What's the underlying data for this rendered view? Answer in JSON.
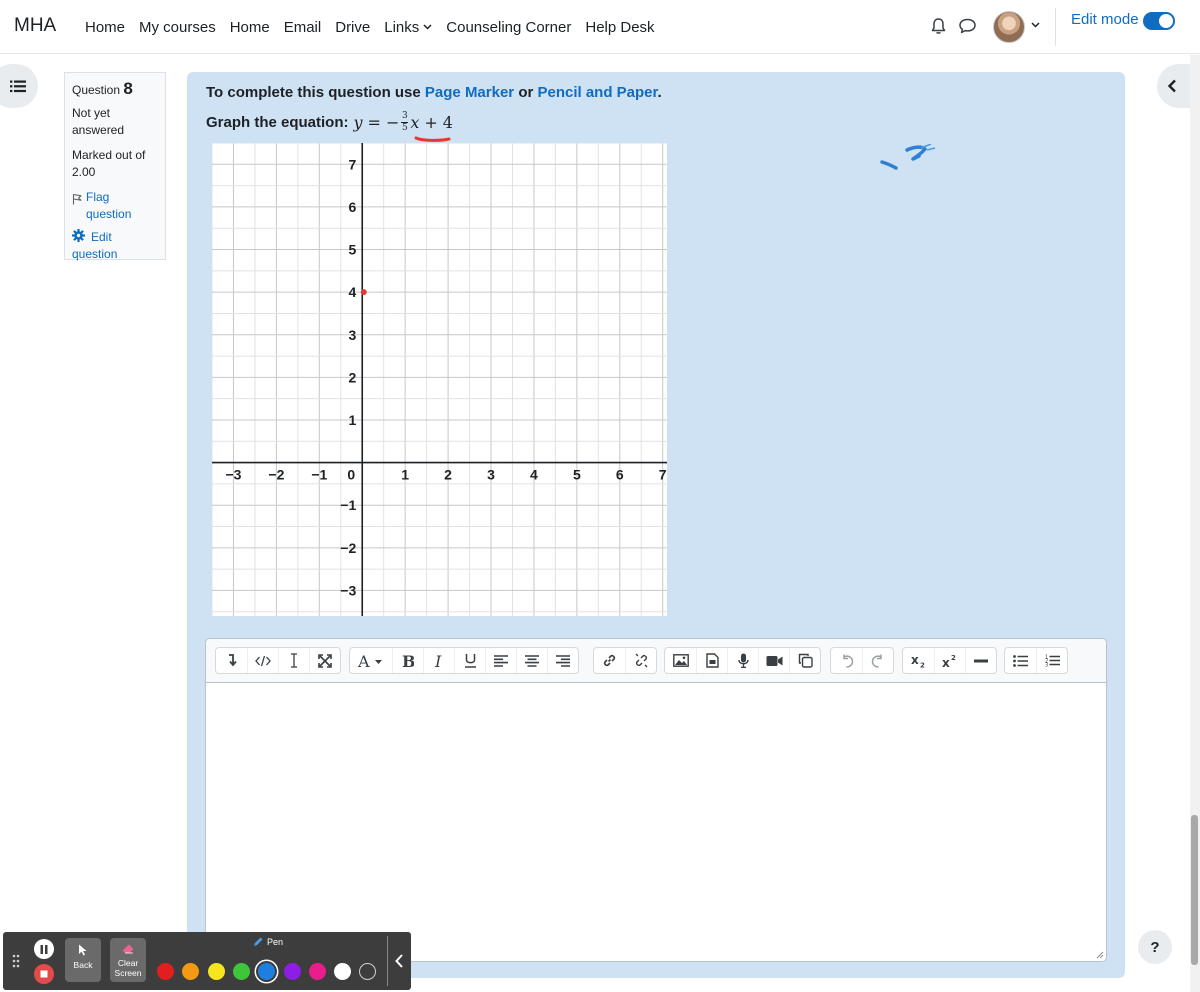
{
  "navbar": {
    "brand": "MHA",
    "links": [
      {
        "label": "Home"
      },
      {
        "label": "My courses"
      },
      {
        "label": "Home"
      },
      {
        "label": "Email"
      },
      {
        "label": "Drive"
      },
      {
        "label": "Links"
      },
      {
        "label": "Counseling Corner"
      },
      {
        "label": "Help Desk"
      }
    ],
    "edit_mode_label": "Edit mode",
    "edit_mode_on": true,
    "accent": "#0f6cbf"
  },
  "question_info": {
    "prefix": "Question",
    "number": "8",
    "state": "Not yet answered",
    "grade": "Marked out of 2.00",
    "flag_label": "Flag question",
    "edit_label": "Edit question"
  },
  "question": {
    "instruction_prefix": "To complete this question use",
    "link1": "Page Marker",
    "conj": "or",
    "link2": "Pencil and Paper",
    "end": ".",
    "prompt": "Graph the equation:",
    "eq_y": "y",
    "eq_eq": "=",
    "eq_minus": "−",
    "eq_num": "3",
    "eq_den": "5",
    "eq_x": "x",
    "eq_plus": "+",
    "eq_const": "4",
    "panel_color": "#cfe2f3"
  },
  "graph": {
    "x_ticks": [
      "−3",
      "−2",
      "−1",
      "0",
      "1",
      "2",
      "3",
      "4",
      "5",
      "6",
      "7"
    ],
    "y_ticks": [
      "7",
      "6",
      "5",
      "4",
      "3",
      "2",
      "1",
      "−1",
      "−2",
      "−3"
    ],
    "x_range": [
      -3.5,
      7.1
    ],
    "y_range": [
      -3.6,
      7.5
    ],
    "plotted_point": {
      "x": 0,
      "y": 4,
      "color": "#e53935"
    }
  },
  "editor": {
    "toolbar_icons": [
      [
        "arrow-down-icon",
        "code-icon",
        "text-cursor-icon",
        "fullscreen-icon"
      ],
      [
        "font-color-icon",
        "bold-icon",
        "italic-icon",
        "underline-icon",
        "align-left-icon",
        "align-center-icon",
        "align-right-icon"
      ],
      [
        "link-icon",
        "unlink-icon"
      ],
      [
        "image-icon",
        "media-icon",
        "microphone-icon",
        "video-icon",
        "copy-icon"
      ],
      [
        "undo-icon",
        "redo-icon"
      ],
      [
        "subscript-icon",
        "superscript-icon",
        "horizontal-rule-icon"
      ],
      [
        "bullet-list-icon",
        "numbered-list-icon"
      ]
    ],
    "content": ""
  },
  "palette": {
    "back_label": "Back",
    "clear_label": "Clear Screen",
    "pen_label": "Pen",
    "swatches": [
      "#e31e1e",
      "#f39a12",
      "#f5e61e",
      "#3fc53a",
      "#1f7fe0",
      "#8e1ee6",
      "#e91e8c",
      "#ffffff",
      "#3d3d3d"
    ],
    "selected_swatch": 4
  },
  "help_label": "?"
}
